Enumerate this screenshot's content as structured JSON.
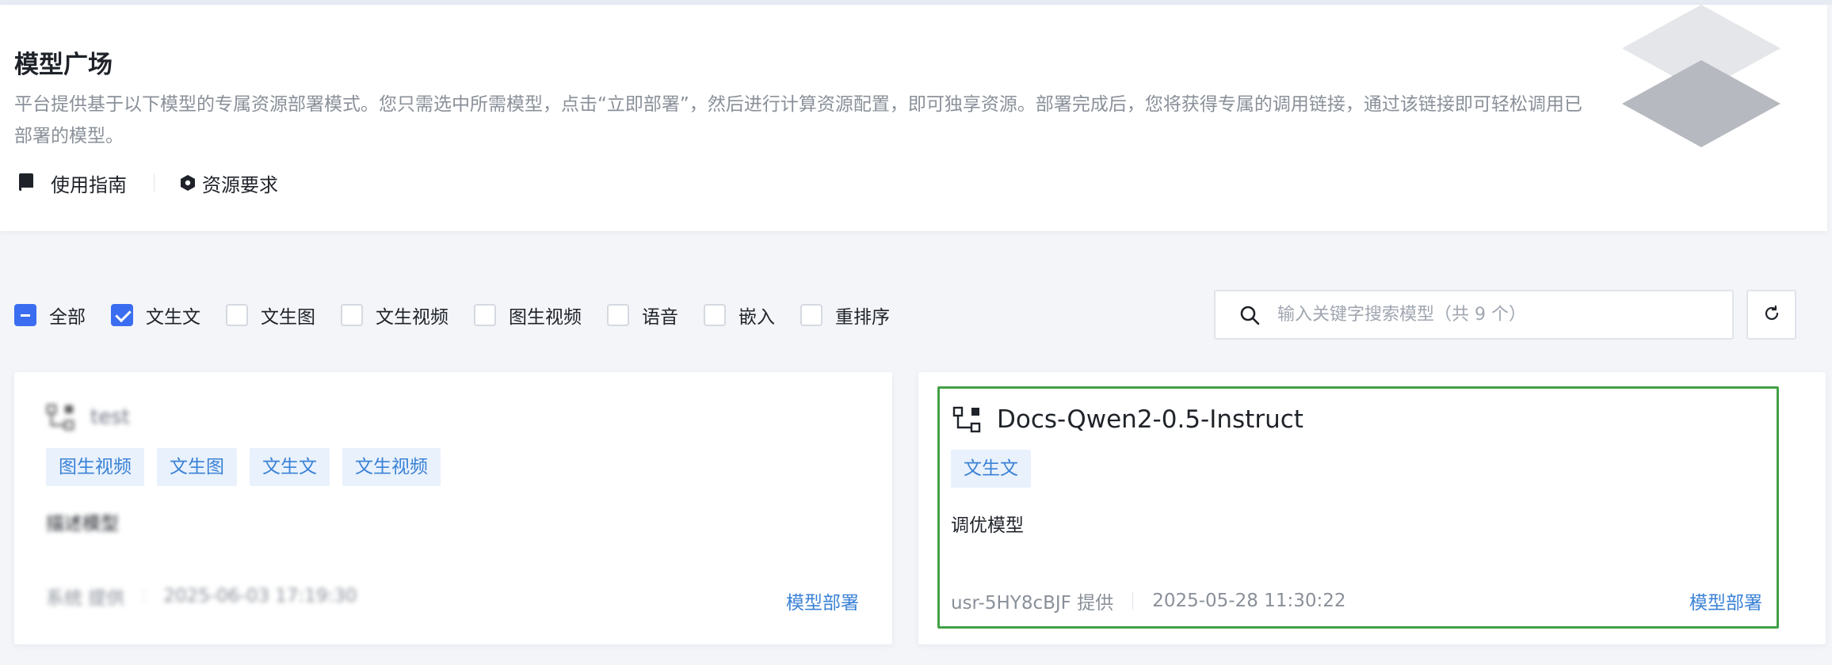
{
  "header": {
    "title": "模型广场",
    "description": "平台提供基于以下模型的专属资源部署模式。您只需选中所需模型，点击“立即部署”，然后进行计算资源配置，即可独享资源。部署完成后，您将获得专属的调用链接，通过该链接即可轻松调用已部署的模型。",
    "links": [
      {
        "label": "使用指南",
        "icon": "book-icon"
      },
      {
        "label": "资源要求",
        "icon": "hexagon-icon"
      }
    ]
  },
  "filters": [
    {
      "label": "全部",
      "state": "indeterminate"
    },
    {
      "label": "文生文",
      "state": "checked"
    },
    {
      "label": "文生图",
      "state": "unchecked"
    },
    {
      "label": "文生视频",
      "state": "unchecked"
    },
    {
      "label": "图生视频",
      "state": "unchecked"
    },
    {
      "label": "语音",
      "state": "unchecked"
    },
    {
      "label": "嵌入",
      "state": "unchecked"
    },
    {
      "label": "重排序",
      "state": "unchecked"
    }
  ],
  "search": {
    "placeholder": "输入关键字搜索模型（共 9 个）",
    "value": ""
  },
  "colors": {
    "accent": "#3b6df0",
    "tag_text": "#3b82d6",
    "tag_bg": "#e8f1fc",
    "highlight_border": "#43a047"
  },
  "cards": [
    {
      "title": "test",
      "blurred": true,
      "tags": [
        "图生视频",
        "文生图",
        "文生文",
        "文生视频"
      ],
      "description": "描述模型",
      "provider": "系统 提供",
      "date": "2025-06-03 17:19:30",
      "action": "模型部署"
    },
    {
      "title": "Docs-Qwen2-0.5-Instruct",
      "blurred": false,
      "tags": [
        "文生文"
      ],
      "description": "调优模型",
      "provider": "usr-5HY8cBJF 提供",
      "date": "2025-05-28 11:30:22",
      "action": "模型部署"
    }
  ]
}
